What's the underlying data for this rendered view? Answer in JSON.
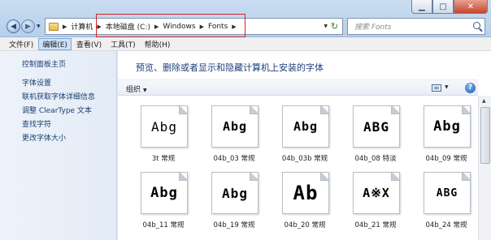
{
  "window": {
    "controls": {
      "minimize": "▁",
      "maximize": "□",
      "close": "✕"
    }
  },
  "address": {
    "crumbs": [
      "计算机",
      "本地磁盘 (C:)",
      "Windows",
      "Fonts"
    ],
    "search_placeholder": "搜索 Fonts"
  },
  "menu": [
    "文件(F)",
    "编辑(E)",
    "查看(V)",
    "工具(T)",
    "帮助(H)"
  ],
  "sidebar": {
    "home": "控制面板主页",
    "links": [
      "字体设置",
      "联机获取字体详细信息",
      "调整 ClearType 文本",
      "查找字符",
      "更改字体大小"
    ]
  },
  "main": {
    "title": "预览、删除或者显示和隐藏计算机上安装的字体",
    "organize": "组织",
    "fonts": [
      {
        "name": "3t 常规",
        "sample": "Abg"
      },
      {
        "name": "04b_03 常规",
        "sample": "Abg"
      },
      {
        "name": "04b_03b 常规",
        "sample": "Abg"
      },
      {
        "name": "04b_08 特淡",
        "sample": "ABG"
      },
      {
        "name": "04b_09 常规",
        "sample": "Abg"
      },
      {
        "name": "04b_11 常规",
        "sample": "Abg"
      },
      {
        "name": "04b_19 常规",
        "sample": "Abg"
      },
      {
        "name": "04b_20 常规",
        "sample": "Ab"
      },
      {
        "name": "04b_21 常规",
        "sample": "A※X"
      },
      {
        "name": "04b_24 常规",
        "sample": "ABG"
      }
    ]
  }
}
